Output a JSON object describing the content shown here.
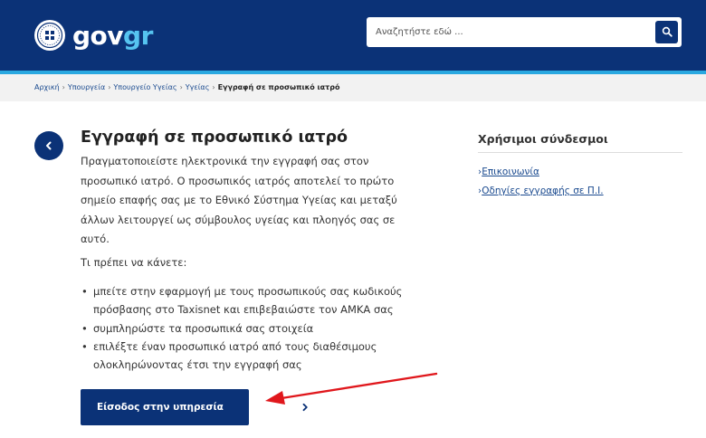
{
  "header": {
    "logo_text_a": "gov",
    "logo_text_b": "gr",
    "search": {
      "placeholder": "Αναζητήστε εδώ ...",
      "button_icon": "search-icon"
    }
  },
  "breadcrumb": {
    "items": [
      "Αρχική",
      "Υπουργεία",
      "Υπουργείο Υγείας",
      "Υγείας"
    ],
    "current": "Εγγραφή σε προσωπικό ιατρό",
    "separator": "›"
  },
  "main": {
    "back_icon": "chevron-left-icon",
    "title": "Εγγραφή σε προσωπικό ιατρό",
    "intro": "Πραγματοποιείστε ηλεκτρονικά την εγγραφή σας στον προσωπικό ιατρό. Ο προσωπικός ιατρός αποτελεί το πρώτο σημείο επαφής σας με το Εθνικό Σύστημα Υγείας και μεταξύ άλλων λειτουργεί ως σύμβουλος υγείας και πλοηγός σας σε αυτό.",
    "todo_heading": "Τι πρέπει να κάνετε:",
    "steps": [
      "μπείτε στην εφαρμογή με τους προσωπικούς σας κωδικούς πρόσβασης στο Taxisnet και επιβεβαιώστε τον ΑΜΚΑ σας",
      "συμπληρώστε τα προσωπικά σας στοιχεία",
      "επιλέξτε έναν προσωπικό ιατρό από τους διαθέσιμους ολοκληρώνοντας έτσι την εγγραφή σας"
    ],
    "cta_label": "Είσοδος στην υπηρεσία",
    "cta_icon": "chevron-right-icon"
  },
  "sidebar": {
    "title": "Χρήσιμοι σύνδεσμοι",
    "links": [
      "Επικοινωνία",
      "Οδηγίες εγγραφής σε Π.Ι."
    ]
  },
  "colors": {
    "header_bg": "#0b3277",
    "header_stripe": "#2aa8e0",
    "logo_accent": "#56c4f0",
    "annotation_arrow": "#e0171c"
  }
}
